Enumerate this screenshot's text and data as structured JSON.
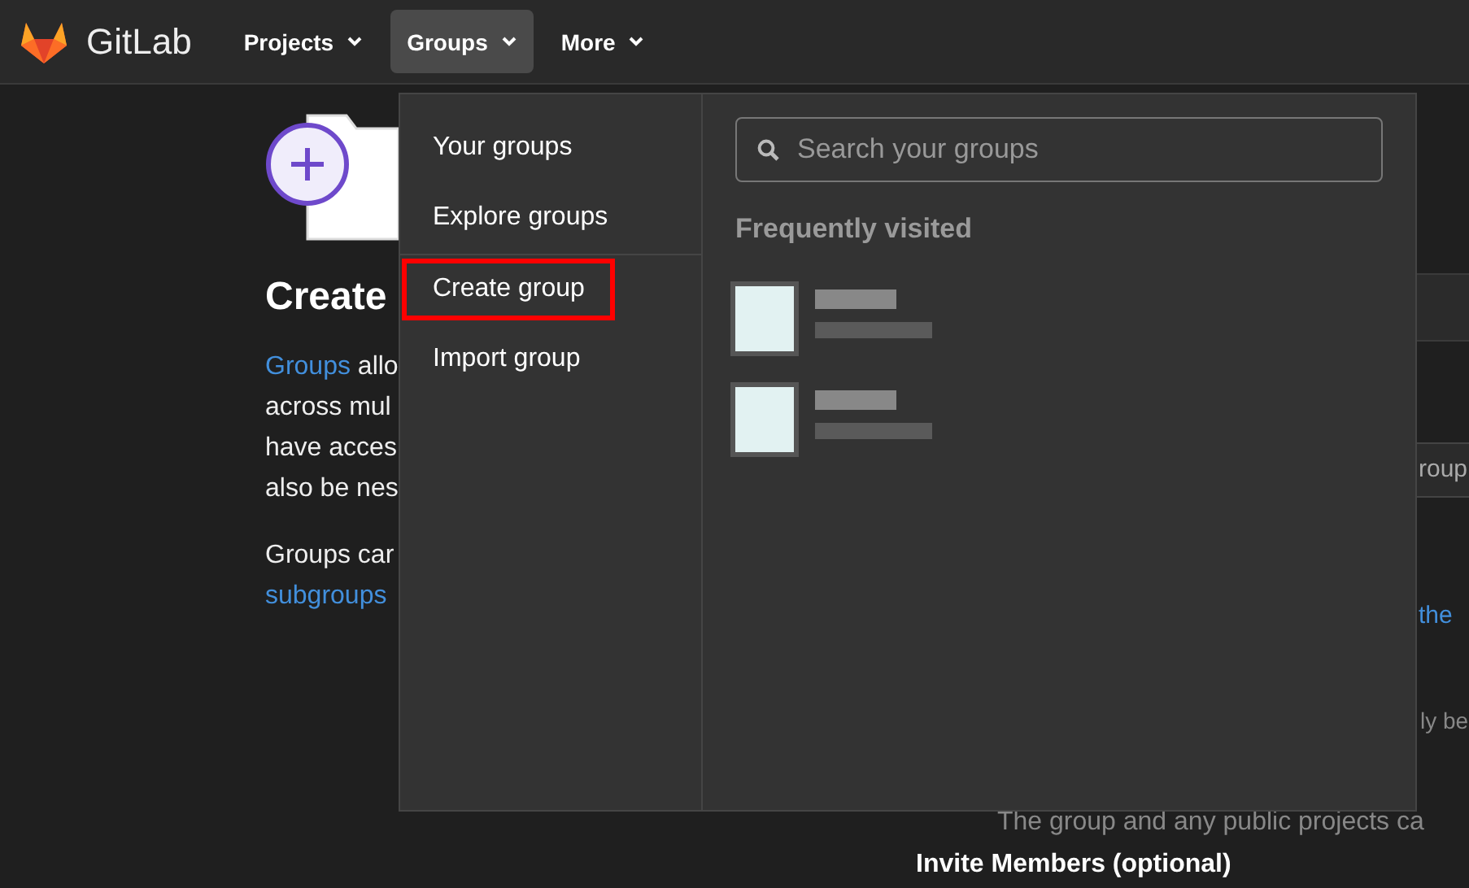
{
  "navbar": {
    "brand": "GitLab",
    "items": [
      {
        "label": "Projects",
        "selected": false
      },
      {
        "label": "Groups",
        "selected": true
      },
      {
        "label": "More",
        "selected": false
      }
    ]
  },
  "page": {
    "heading": "Create",
    "paragraphs": [
      [
        [
          {
            "kind": "link",
            "text": "Groups"
          },
          {
            "kind": "text",
            "text": " allo"
          }
        ],
        [
          {
            "kind": "text",
            "text": "across mul"
          }
        ],
        [
          {
            "kind": "text",
            "text": "have acces"
          }
        ],
        [
          {
            "kind": "text",
            "text": "also be nes"
          }
        ]
      ],
      [
        [
          {
            "kind": "text",
            "text": "Groups car"
          }
        ],
        [
          {
            "kind": "link",
            "text": "subgroups"
          }
        ]
      ]
    ],
    "right": {
      "field_text": "roup",
      "link_text": "the",
      "hint_text": "ly be",
      "note": "The group and any public projects ca",
      "section_title": "Invite Members (optional)"
    }
  },
  "dropdown": {
    "menu": [
      {
        "label": "Your groups",
        "highlighted": false
      },
      {
        "label": "Explore groups",
        "highlighted": false
      },
      {
        "kind": "divider"
      },
      {
        "label": "Create group",
        "highlighted": true
      },
      {
        "label": "Import group",
        "highlighted": false
      }
    ],
    "search": {
      "placeholder": "Search your groups"
    },
    "frequent_title": "Frequently visited",
    "frequent": [
      {
        "kind": "redacted"
      },
      {
        "kind": "redacted"
      }
    ]
  }
}
